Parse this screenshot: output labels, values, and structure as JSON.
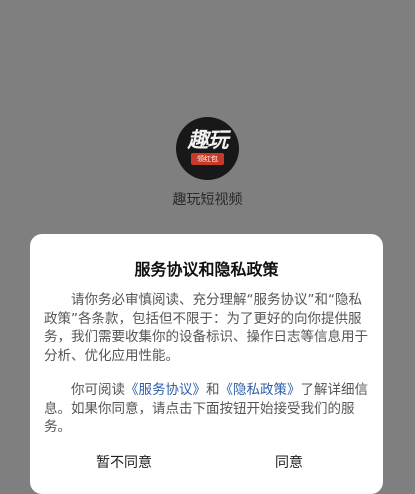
{
  "app": {
    "logo_text": "趣玩",
    "logo_badge": "领红包",
    "name": "趣玩短视频"
  },
  "dialog": {
    "title": "服务协议和隐私政策",
    "paragraph1": "请你务必审慎阅读、充分理解“服务协议”和“隐私政策”各条款，包括但不限于：为了更好的向你提供服务，我们需要收集你的设备标识、操作日志等信息用于分析、优化应用性能。",
    "paragraph2_prefix": "你可阅读",
    "service_link": "《服务协议》",
    "paragraph2_and": "和",
    "privacy_link": "《隐私政策》",
    "paragraph2_suffix": "了解详细信息。如果你同意，请点击下面按钮开始接受我们的服务。",
    "disagree_label": "暂不同意",
    "agree_label": "同意"
  }
}
